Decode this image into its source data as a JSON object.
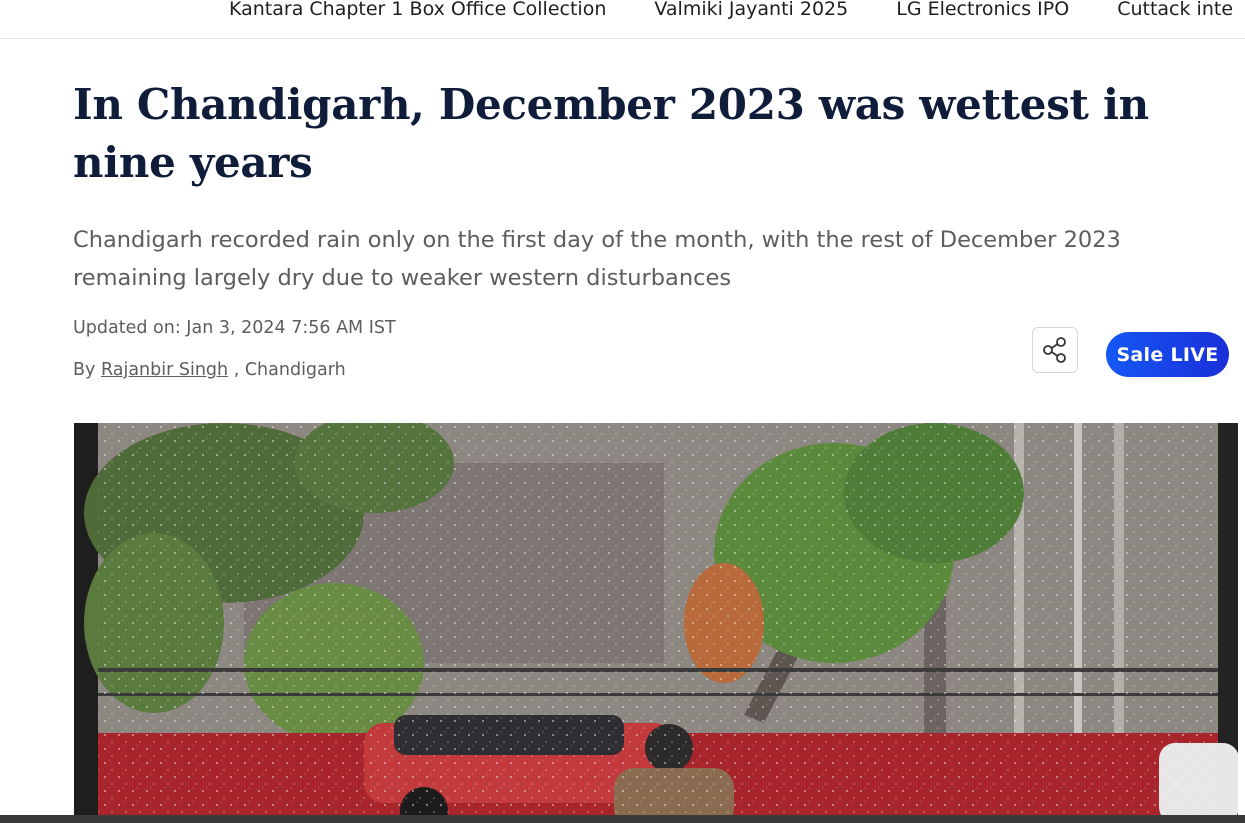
{
  "trending": {
    "items": [
      "Kantara Chapter 1 Box Office Collection",
      "Valmiki Jayanti 2025",
      "LG Electronics IPO",
      "Cuttack inte"
    ]
  },
  "article": {
    "headline": "In Chandigarh, December 2023 was wettest in nine years",
    "summary": "Chandigarh recorded rain only on the first day of the month, with the rest of December 2023 remaining largely dry due to weaker western disturbances",
    "updated": "Updated on: Jan 3, 2024 7:56 AM IST",
    "byline_prefix": "By",
    "author": "Rajanbir Singh",
    "location": ", Chandigarh"
  },
  "actions": {
    "share_icon": "share-icon",
    "sale_label": "Sale LIVE",
    "sale_color": "#1558f5"
  },
  "colors": {
    "headline": "#0f1d3a",
    "body_text": "#5d5d5d"
  }
}
